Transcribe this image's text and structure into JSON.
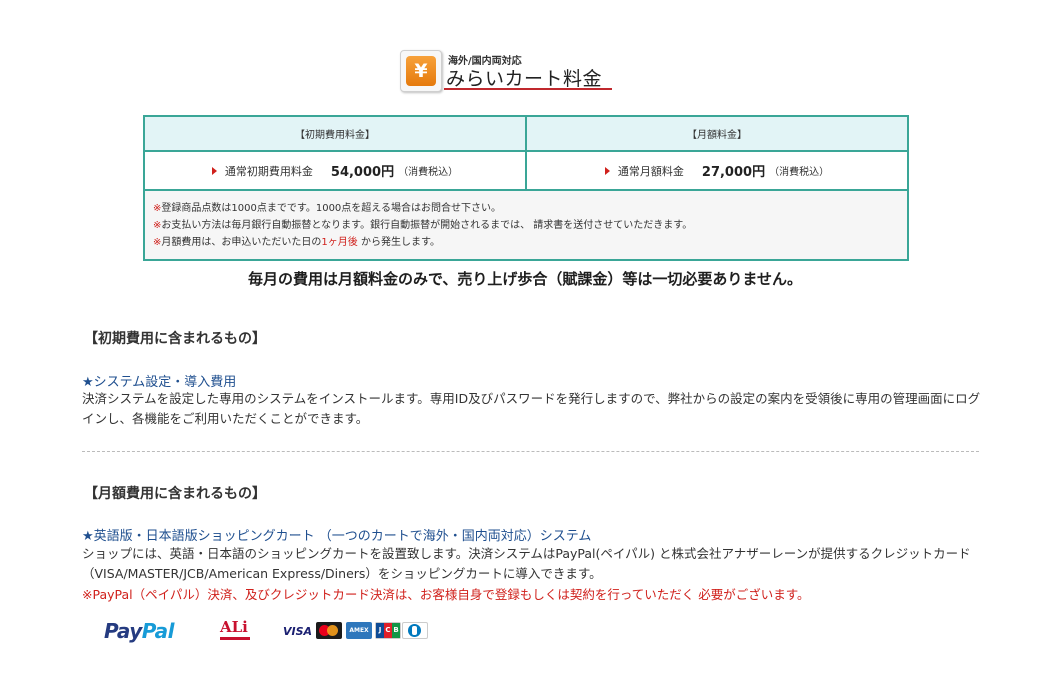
{
  "title": {
    "icon_glyph": "¥",
    "subtitle": "海外/国内両対応",
    "main": "みらいカート料金",
    "accent_color": "#c0282d"
  },
  "price_table": {
    "headers": [
      "【初期費用料金】",
      "【月額料金】"
    ],
    "rows": [
      {
        "label": "通常初期費用料金",
        "amount": "54,000円",
        "tax": "（消費税込）"
      },
      {
        "label": "通常月額料金",
        "amount": "27,000円",
        "tax": "（消費税込）"
      }
    ],
    "notes": [
      {
        "mark": "※",
        "text": "登録商品点数は1000点までです。1000点を超える場合はお問合せ下さい。"
      },
      {
        "mark": "※",
        "text": "お支払い方法は毎月銀行自動振替となります。銀行自動振替が開始されるまでは、 請求書を送付させていただきます。"
      },
      {
        "mark": "※",
        "text_before": "月額費用は、お申込いただいた日の",
        "emphasis": "1ヶ月後",
        "text_after": " から発生します。"
      }
    ],
    "border_color": "#3aa697",
    "header_bg": "#e2f4f6"
  },
  "headline": "毎月の費用は月額料金のみで、売り上げ歩合（賦課金）等は一切必要ありません。",
  "initial_section": {
    "heading": "【初期費用に含まれるもの】",
    "item_title": "★システム設定・導入費用",
    "body": "決済システムを設定した専用のシステムをインストールます。専用ID及びパスワードを発行しますので、弊社からの設定の案内を受領後に専用の管理画面にログインし、各機能をご利用いただくことができます。"
  },
  "monthly_section": {
    "heading": "【月額費用に含まれるもの】",
    "item_title": "★英語版・日本語版ショッピングカート （一つのカートで海外・国内両対応）システム",
    "body": "ショップには、英語・日本語のショッピングカートを設置致します。決済システムはPayPal(ペイパル) と株式会社アナザーレーンが提供するクレジットカード（VISA/MASTER/JCB/American Express/Diners）をショッピングカートに導入できます。",
    "warning": "※PayPal（ペイパル）決済、及びクレジットカード決済は、お客様自身で登録もしくは契約を行っていただく 必要がございます。"
  },
  "logos": {
    "paypal_part1": "Pay",
    "paypal_part2": "Pal",
    "ali": "ALi",
    "visa": "VISA",
    "amex": "AMEX",
    "jcb": [
      "J",
      "C",
      "B"
    ]
  },
  "colors": {
    "link": "#1f4f8f",
    "warning": "#d0211c"
  }
}
